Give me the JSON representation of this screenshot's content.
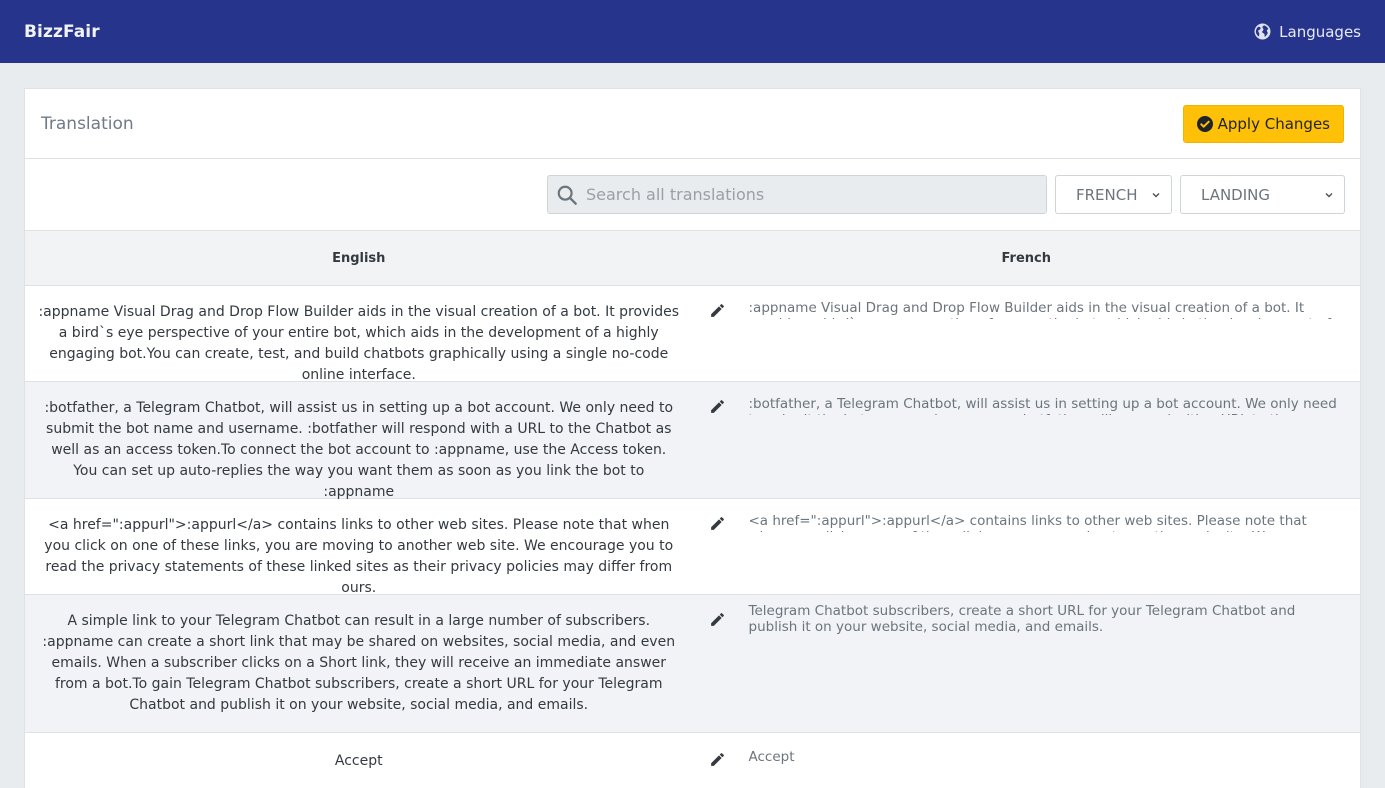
{
  "app": {
    "brand": "BizzFair",
    "languages_label": "Languages"
  },
  "card": {
    "title": "Translation",
    "apply_label": "Apply Changes"
  },
  "filters": {
    "search_placeholder": "Search all translations",
    "language_selected": "FRENCH",
    "page_selected": "LANDING"
  },
  "table": {
    "headers": [
      "English",
      "French"
    ],
    "rows": [
      {
        "english": ":appname Visual Drag and Drop Flow Builder aids in the visual creation of a bot. It provides a bird`s eye perspective of your entire bot, which aids in the development of a highly engaging bot.You can create, test, and build chatbots graphically using a single no-code online interface.",
        "french": ":appname Visual Drag and Drop Flow Builder aids in the visual creation of a bot. It provides a bird`s eye perspective of your entire bot, which aids in the development of a highly engaging bot.You can"
      },
      {
        "english": ":botfather, a Telegram Chatbot, will assist us in setting up a bot account. We only need to submit the bot name and username. :botfather will respond with a URL to the Chatbot as well as an access token.To connect the bot account to :appname, use the Access token. You can set up auto-replies the way you want them as soon as you link the bot to :appname",
        "french": ":botfather, a Telegram Chatbot, will assist us in setting up a bot account. We only need to submit the bot name and username. :botfather will respond with a URL to the Chatbot as well as an access"
      },
      {
        "english": "<a href=\":appurl\">:appurl</a> contains links to other web sites. Please note that when you click on one of these links, you are moving to another web site. We encourage you to read the privacy statements of these linked sites as their privacy policies may differ from ours.",
        "french": "<a href=\":appurl\">:appurl</a> contains links to other web sites. Please note that when you click on one of these links, you are moving to another web site. We encourage you to read the privacy"
      },
      {
        "english": "A simple link to your Telegram Chatbot can result in a large number of subscribers. :appname can create a short link that may be shared on websites, social media, and even emails. When a subscriber clicks on a Short link, they will receive an immediate answer from a bot.To gain Telegram Chatbot subscribers, create a short URL for your Telegram Chatbot and publish it on your website, social media, and emails.",
        "french": "Telegram Chatbot subscribers, create a short URL for your Telegram Chatbot and publish it on your website, social media, and emails."
      },
      {
        "english": "Accept",
        "french": "Accept"
      }
    ]
  },
  "colors": {
    "topbar": "#27348b",
    "apply_button": "#ffc107"
  },
  "icons": {
    "languages": "globe-icon",
    "apply": "check-circle-icon",
    "search": "search-icon",
    "edit": "pencil-icon",
    "dropdown": "chevron-down-icon"
  }
}
